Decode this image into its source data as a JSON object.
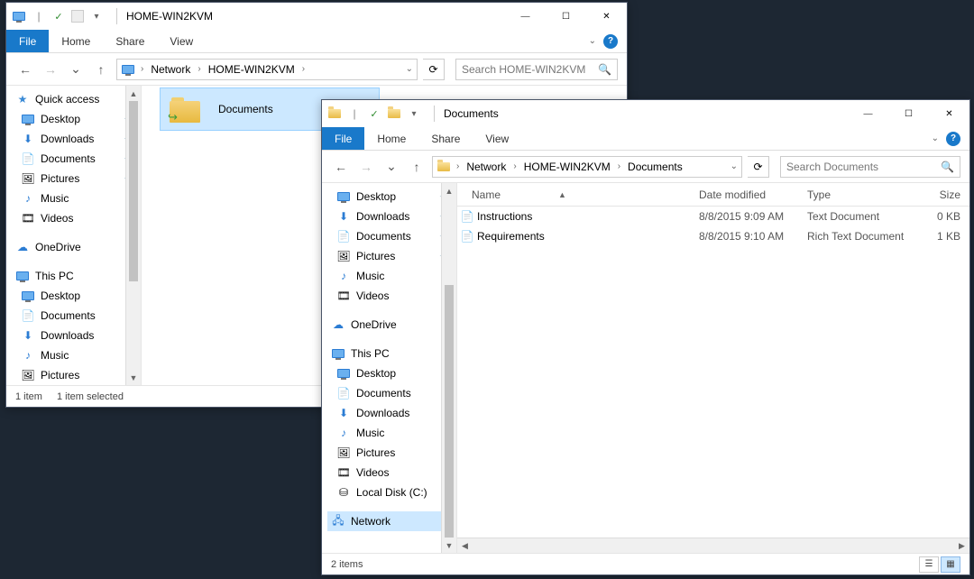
{
  "win1": {
    "title": "HOME-WIN2KVM",
    "tabs": {
      "file": "File",
      "home": "Home",
      "share": "Share",
      "view": "View"
    },
    "breadcrumb": {
      "root": "Network",
      "host": "HOME-WIN2KVM"
    },
    "search_placeholder": "Search HOME-WIN2KVM",
    "selected_folder": "Documents",
    "nav": {
      "quick": "Quick access",
      "desktop": "Desktop",
      "downloads": "Downloads",
      "documents": "Documents",
      "pictures": "Pictures",
      "music": "Music",
      "videos": "Videos",
      "onedrive": "OneDrive",
      "thispc": "This PC",
      "pc_desktop": "Desktop",
      "pc_documents": "Documents",
      "pc_downloads": "Downloads",
      "pc_music": "Music",
      "pc_pictures": "Pictures"
    },
    "status": {
      "count": "1 item",
      "sel": "1 item selected"
    }
  },
  "win2": {
    "title": "Documents",
    "tabs": {
      "file": "File",
      "home": "Home",
      "share": "Share",
      "view": "View"
    },
    "breadcrumb": {
      "root": "Network",
      "host": "HOME-WIN2KVM",
      "folder": "Documents"
    },
    "search_placeholder": "Search Documents",
    "nav": {
      "desktop": "Desktop",
      "downloads": "Downloads",
      "documents": "Documents",
      "pictures": "Pictures",
      "music": "Music",
      "videos": "Videos",
      "onedrive": "OneDrive",
      "thispc": "This PC",
      "pc_desktop": "Desktop",
      "pc_documents": "Documents",
      "pc_downloads": "Downloads",
      "pc_music": "Music",
      "pc_pictures": "Pictures",
      "pc_videos": "Videos",
      "pc_localdisk": "Local Disk (C:)",
      "network": "Network"
    },
    "columns": {
      "name": "Name",
      "date": "Date modified",
      "type": "Type",
      "size": "Size"
    },
    "files": [
      {
        "name": "Instructions",
        "date": "8/8/2015 9:09 AM",
        "type": "Text Document",
        "size": "0 KB"
      },
      {
        "name": "Requirements",
        "date": "8/8/2015 9:10 AM",
        "type": "Rich Text Document",
        "size": "1 KB"
      }
    ],
    "status": {
      "count": "2 items"
    }
  }
}
